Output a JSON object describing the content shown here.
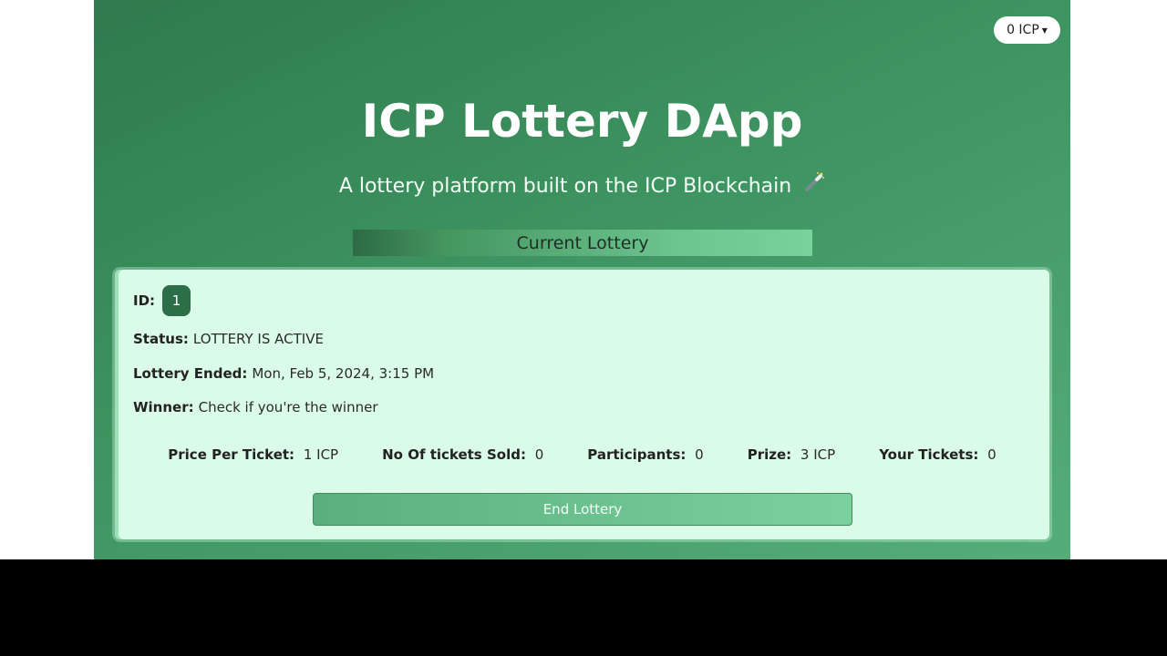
{
  "header": {
    "wallet_balance": "0 ICP"
  },
  "hero": {
    "title": "ICP Lottery DApp",
    "subtitle": "A lottery platform built on the ICP Blockchain"
  },
  "section": {
    "tab_label": "Current Lottery"
  },
  "lottery": {
    "id_label": "ID:",
    "id_value": "1",
    "status_label": "Status:",
    "status_value": "LOTTERY IS ACTIVE",
    "ended_label": "Lottery Ended:",
    "ended_value": "Mon, Feb 5, 2024, 3:15 PM",
    "winner_label": "Winner:",
    "winner_value": "Check if you're the winner",
    "stats": [
      {
        "label": "Price Per Ticket:",
        "value": "1 ICP"
      },
      {
        "label": "No Of tickets Sold:",
        "value": "0"
      },
      {
        "label": "Participants:",
        "value": "0"
      },
      {
        "label": "Prize:",
        "value": "3 ICP"
      },
      {
        "label": "Your Tickets:",
        "value": "0"
      }
    ],
    "end_button_label": "End Lottery"
  },
  "colors": {
    "app_gradient_start": "#2f7a4e",
    "app_gradient_end": "#55ad79",
    "card_background": "#dafbe8",
    "id_badge": "#2c6e47",
    "button_green": "#6ec491"
  },
  "icons": {
    "caret": "caret-down-icon",
    "wand": "magic-wand-icon"
  }
}
